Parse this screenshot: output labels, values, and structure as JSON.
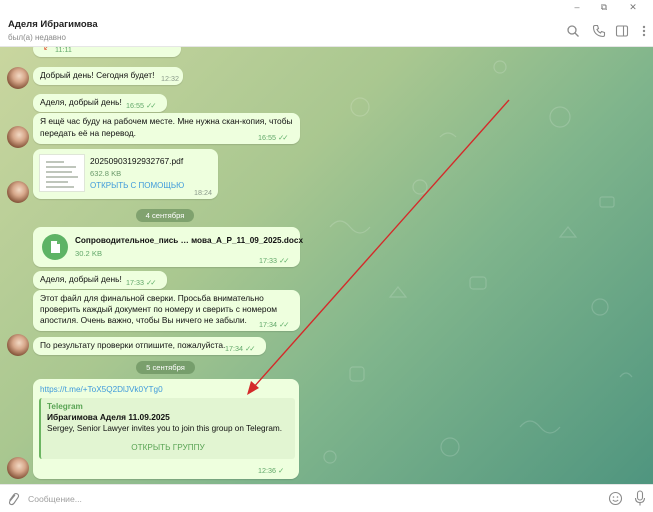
{
  "window": {
    "minimize": "–",
    "maximize": "⧉",
    "close": "✕"
  },
  "chat": {
    "name": "Аделя Ибрагимова",
    "status": "был(а) недавно"
  },
  "messages": {
    "top_time": "11:11",
    "m1": {
      "text": "Добрый день! Сегодня будет!",
      "time": "12:32"
    },
    "m2": {
      "text": "Аделя, добрый день!",
      "time": "16:55"
    },
    "m3": {
      "line1": "Я ещё час буду на рабочем месте. Мне нужна скан-копия, чтобы",
      "line2": "передать её на перевод.",
      "time": "16:55"
    },
    "m4": {
      "filename": "20250903192932767.pdf",
      "size": "632.8 KB",
      "action": "ОТКРЫТЬ С ПОМОЩЬЮ",
      "time": "18:24"
    },
    "date1": "4 сентября",
    "m5": {
      "filename": "Сопроводительное_пись … мова_А_Р_11_09_2025.docx",
      "size": "30.2 KB",
      "time": "17:33"
    },
    "m6": {
      "text": "Аделя, добрый день!",
      "time": "17:33"
    },
    "m7": {
      "line1": "Этот файл для финальной сверки. Просьба внимательно",
      "line2": "проверить каждый документ по номеру и сверить с номером",
      "line3": "апостиля. Очень важно, чтобы Вы ничего не забыли.",
      "time": "17:34"
    },
    "m8": {
      "text": "По результату проверки отпишите, пожалуйста.",
      "time": "17:34"
    },
    "date2": "5 сентября",
    "m9": {
      "link": "https://t.me/+ToX5Q2DlJVk0YTg0",
      "site": "Telegram",
      "title": "Ибрагимова Аделя 11.09.2025",
      "desc": "Sergey, Senior Lawyer invites you to join this group on Telegram.",
      "button": "ОТКРЫТЬ ГРУППУ",
      "time": "12:36"
    }
  },
  "composer": {
    "placeholder": "Сообщение..."
  },
  "colors": {
    "bubble": "#eeffde",
    "accent": "#3f9adb",
    "check": "#5fae68",
    "arrow": "#d42a2a"
  }
}
